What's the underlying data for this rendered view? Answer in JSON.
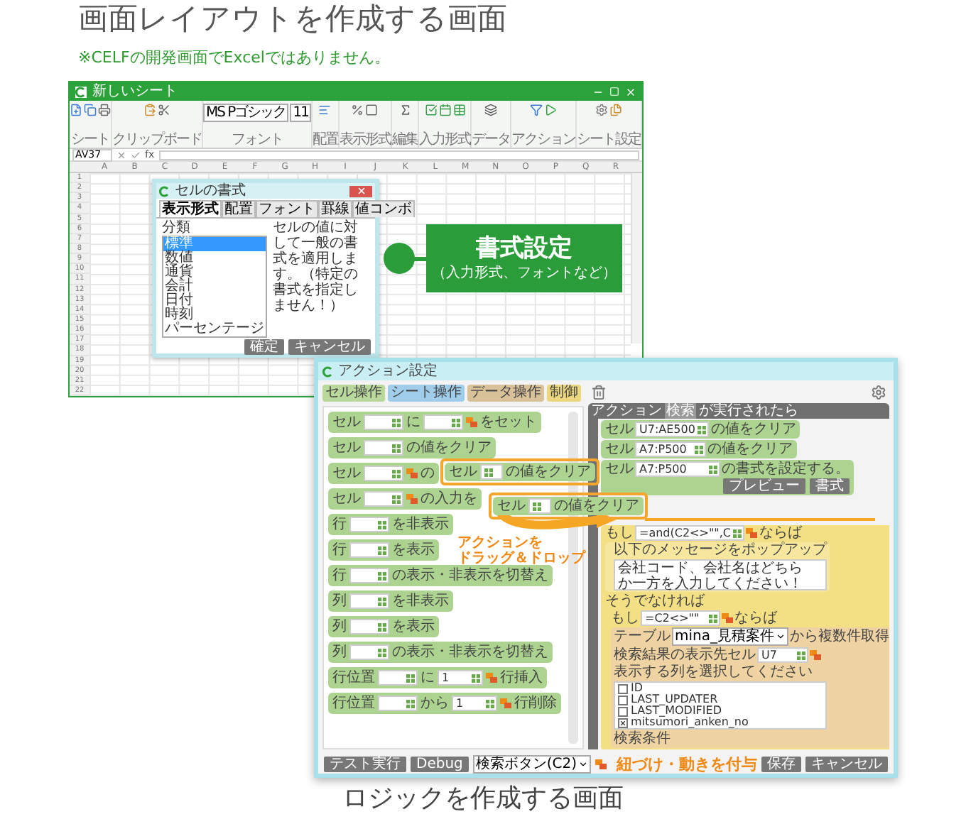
{
  "heading": "画面レイアウトを作成する画面",
  "note": "※CELFの開発画面でExcelではありません。",
  "sheet_window": {
    "title": "新しいシート",
    "font_name": "MS Pゴシック",
    "font_size": "11",
    "ribbon_groups": [
      "シート",
      "クリップボード",
      "フォント",
      "配置",
      "表示形式",
      "編集",
      "入力形式",
      "データ",
      "アクション",
      "シート設定"
    ],
    "name_box": "AV37",
    "formula_label": "fx",
    "columns": [
      "A",
      "B",
      "C",
      "D",
      "E",
      "F",
      "G",
      "H",
      "I",
      "J",
      "K",
      "L",
      "M",
      "N",
      "O",
      "P",
      "Q",
      "R"
    ],
    "rows": [
      "1",
      "2",
      "3",
      "4",
      "5",
      "6",
      "7",
      "8",
      "9",
      "10",
      "11",
      "12",
      "13",
      "14",
      "15",
      "16",
      "17",
      "18",
      "19",
      "20",
      "21",
      "22"
    ]
  },
  "format_dialog": {
    "title": "セルの書式",
    "tabs": [
      {
        "label": "表示形式",
        "selected": true
      },
      {
        "label": "配置",
        "selected": false
      },
      {
        "label": "フォント",
        "selected": false
      },
      {
        "label": "罫線",
        "selected": false
      },
      {
        "label": "値コンボ",
        "selected": false
      }
    ],
    "category_label": "分類",
    "categories": [
      {
        "label": "標準",
        "selected": true
      },
      {
        "label": "数値",
        "selected": false
      },
      {
        "label": "通貨",
        "selected": false
      },
      {
        "label": "会計",
        "selected": false
      },
      {
        "label": "日付",
        "selected": false
      },
      {
        "label": "時刻",
        "selected": false
      },
      {
        "label": "パーセンテージ",
        "selected": false
      }
    ],
    "description": "セルの値に対して一般の書式を適用します。（特定の書式を指定しません！）",
    "buttons": [
      "確定",
      "キャンセル"
    ]
  },
  "callout": {
    "title": "書式設定",
    "subtitle": "（入力形式、フォントなど）"
  },
  "action_window": {
    "title": "アクション設定",
    "palette_tabs": [
      {
        "label": "セル操作",
        "color": "#b9d99c"
      },
      {
        "label": "シート操作",
        "color": "#9fcdea"
      },
      {
        "label": "データ操作",
        "color": "#d9c29a"
      },
      {
        "label": "制御",
        "color": "#ecd77e"
      }
    ],
    "palette_blocks": [
      {
        "parts": [
          {
            "kind": "label",
            "text": "セル"
          },
          {
            "kind": "input"
          },
          {
            "kind": "label",
            "text": "に"
          },
          {
            "kind": "input"
          },
          {
            "kind": "link"
          },
          {
            "kind": "label",
            "text": "をセット"
          }
        ]
      },
      {
        "parts": [
          {
            "kind": "label",
            "text": "セル"
          },
          {
            "kind": "input"
          },
          {
            "kind": "label",
            "text": "の値をクリア"
          }
        ]
      },
      {
        "parts": [
          {
            "kind": "label",
            "text": "セル"
          },
          {
            "kind": "input"
          },
          {
            "kind": "link"
          },
          {
            "kind": "label",
            "text": "の"
          }
        ]
      },
      {
        "parts": [
          {
            "kind": "label",
            "text": "セル"
          },
          {
            "kind": "input"
          },
          {
            "kind": "link"
          },
          {
            "kind": "label",
            "text": "の入力を"
          }
        ]
      },
      {
        "parts": [
          {
            "kind": "label",
            "text": "行"
          },
          {
            "kind": "input"
          },
          {
            "kind": "label",
            "text": "を非表示"
          }
        ]
      },
      {
        "parts": [
          {
            "kind": "label",
            "text": "行"
          },
          {
            "kind": "input"
          },
          {
            "kind": "label",
            "text": "を表示"
          }
        ]
      },
      {
        "parts": [
          {
            "kind": "label",
            "text": "行"
          },
          {
            "kind": "input"
          },
          {
            "kind": "label",
            "text": "の表示・非表示を切替え"
          }
        ]
      },
      {
        "parts": [
          {
            "kind": "label",
            "text": "列"
          },
          {
            "kind": "input"
          },
          {
            "kind": "label",
            "text": "を非表示"
          }
        ]
      },
      {
        "parts": [
          {
            "kind": "label",
            "text": "列"
          },
          {
            "kind": "input"
          },
          {
            "kind": "label",
            "text": "を表示"
          }
        ]
      },
      {
        "parts": [
          {
            "kind": "label",
            "text": "列"
          },
          {
            "kind": "input"
          },
          {
            "kind": "label",
            "text": "の表示・非表示を切替え"
          }
        ]
      },
      {
        "parts": [
          {
            "kind": "label",
            "text": "行位置"
          },
          {
            "kind": "input"
          },
          {
            "kind": "label",
            "text": "に"
          },
          {
            "kind": "input",
            "value": "1"
          },
          {
            "kind": "link"
          },
          {
            "kind": "label",
            "text": "行挿入"
          }
        ]
      },
      {
        "parts": [
          {
            "kind": "label",
            "text": "行位置"
          },
          {
            "kind": "input"
          },
          {
            "kind": "label",
            "text": "から"
          },
          {
            "kind": "input",
            "value": "1"
          },
          {
            "kind": "link"
          },
          {
            "kind": "label",
            "text": "行削除"
          }
        ]
      }
    ],
    "dragged_blocks": [
      {
        "label": "セル",
        "suffix": "の値をクリア"
      },
      {
        "label": "セル",
        "suffix": "の値をクリア"
      }
    ],
    "test_button": "テスト実行",
    "debug_button": "Debug",
    "trigger": "検索ボタン(C2)",
    "event": {
      "prefix": "アクション",
      "name": "検索",
      "suffix": "が実行されたら"
    },
    "cell_actions": [
      {
        "label": "セル",
        "value": "U7:AE500",
        "suffix": "の値をクリア"
      },
      {
        "label": "セル",
        "value": "A7:P500",
        "suffix": "の値をクリア"
      },
      {
        "label": "セル",
        "value": "A7:P500",
        "suffix": "の書式を設定する。",
        "buttons": [
          "プレビュー",
          "書式"
        ]
      }
    ],
    "condition": {
      "label": "もし",
      "value": "=and(C2<>\"\",C",
      "suffix": "ならば",
      "popup_label": "以下のメッセージをポップアップ",
      "message": "会社コード、会社名はどちらか一方を入力してください！",
      "else_label": "そうでなければ",
      "inner": {
        "label": "もし",
        "value": "=C2<>\"\"",
        "suffix": "ならば",
        "table_label": "テーブル",
        "table": "mina_見積案件",
        "table_suffix": "から複数件取得",
        "dest_label": "検索結果の表示先セル",
        "dest": "U7",
        "columns_label": "表示する列を選択してください",
        "columns": [
          {
            "label": "ID",
            "checked": false
          },
          {
            "label": "LAST_UPDATER",
            "checked": false
          },
          {
            "label": "LAST_MODIFIED",
            "checked": false
          },
          {
            "label": "mitsumori_anken_no",
            "checked": true
          }
        ],
        "criteria_label": "検索条件"
      }
    },
    "footer_buttons": [
      "保存",
      "キャンセル"
    ]
  },
  "annotations": {
    "drag": [
      "アクションを",
      "ドラッグ＆ドロップ"
    ],
    "link": "紐づけ・動きを付与"
  },
  "caption": "ロジックを作成する画面"
}
